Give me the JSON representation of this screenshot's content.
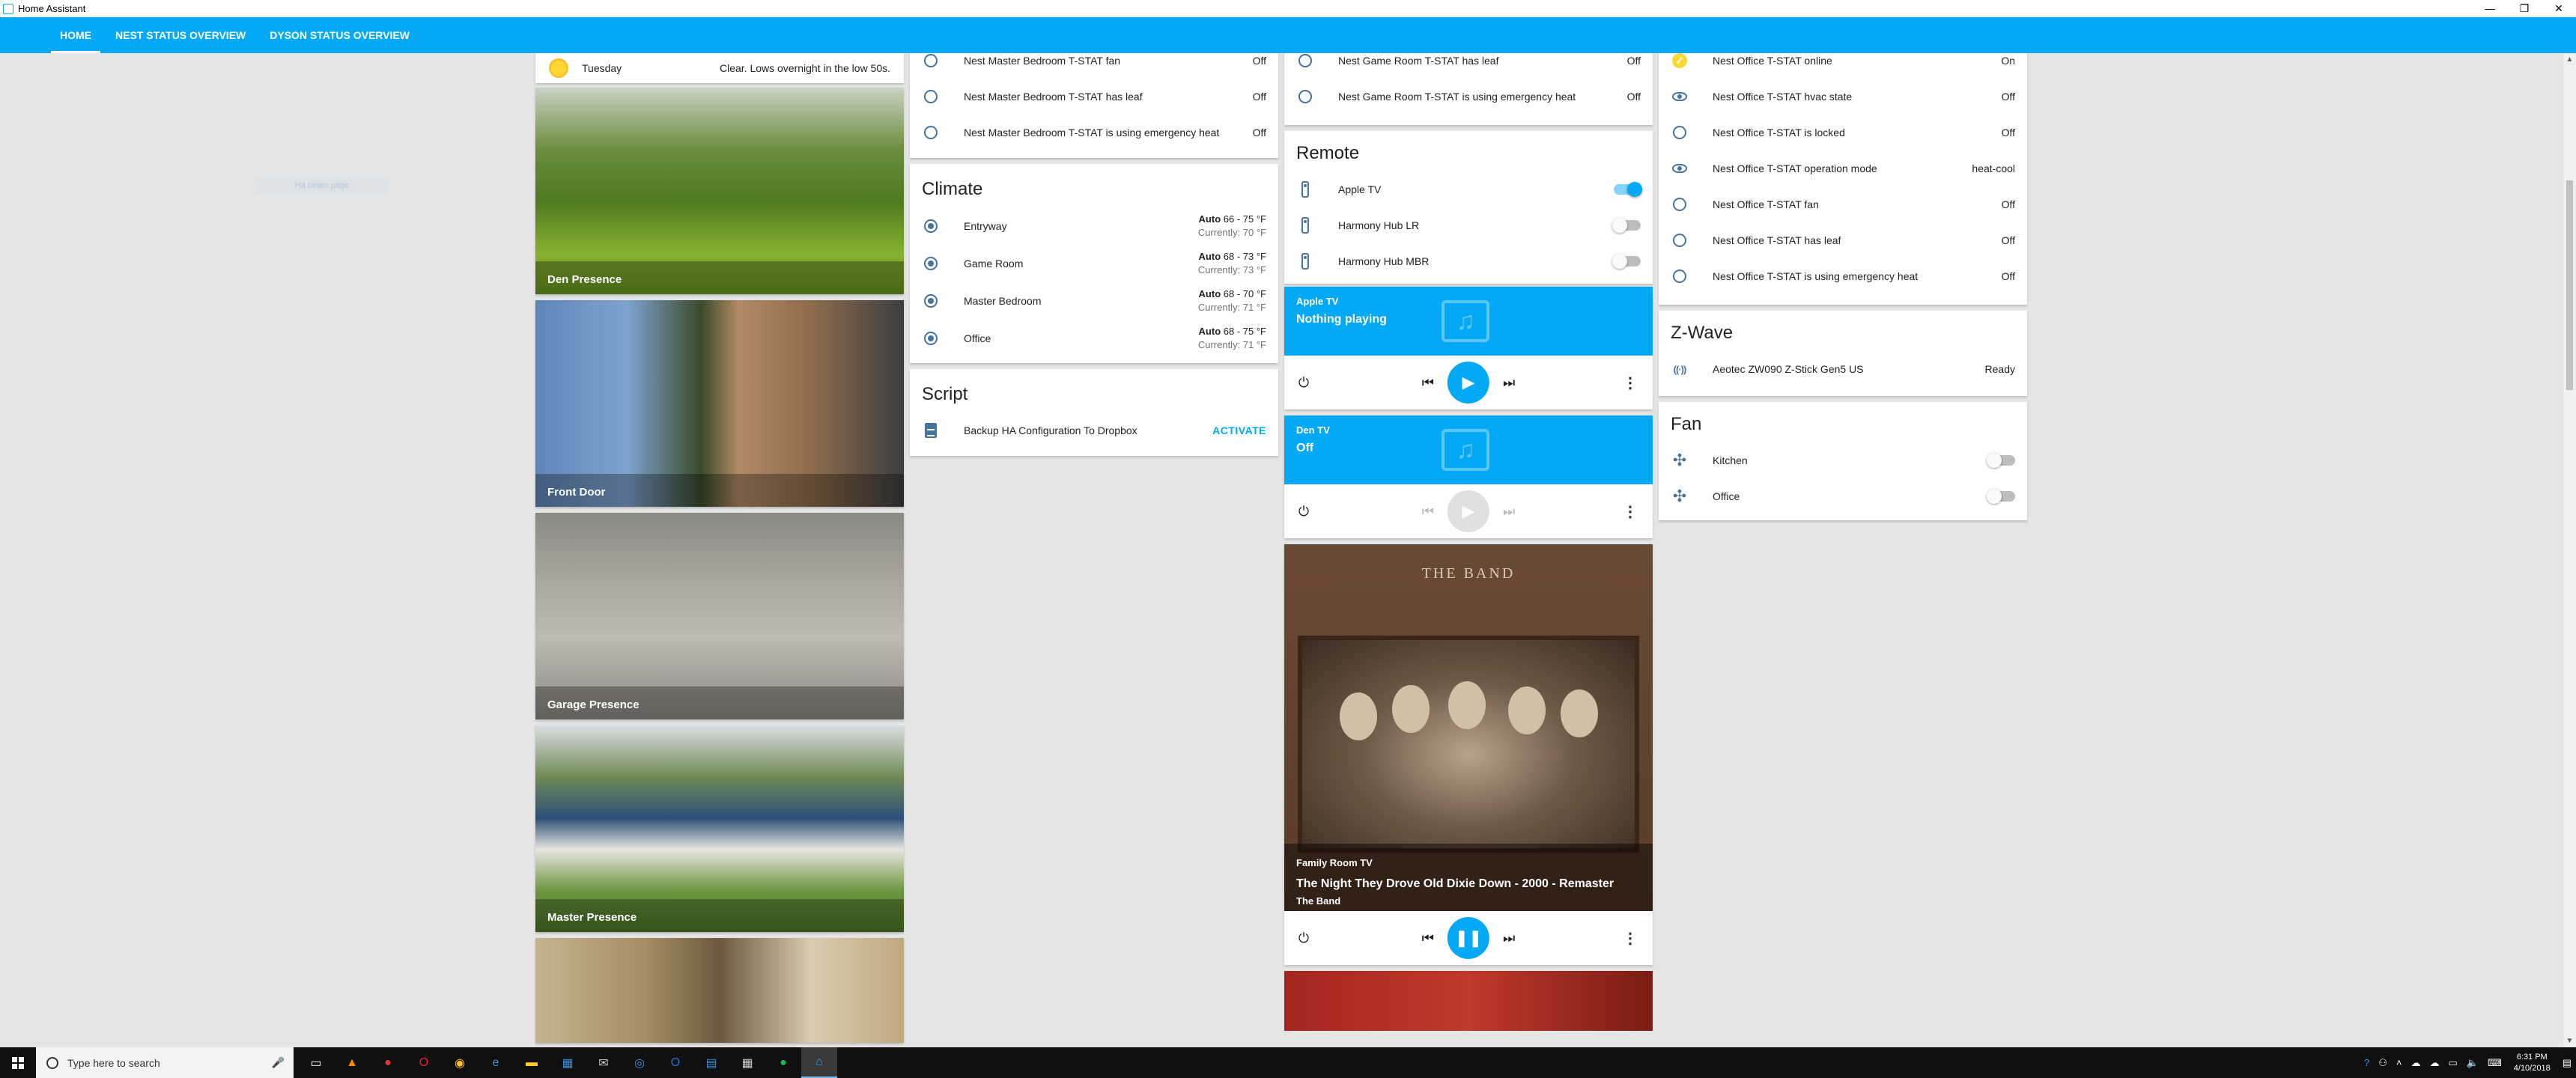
{
  "window": {
    "title": "Home Assistant",
    "minimize": "—",
    "restore": "❐",
    "close": "✕"
  },
  "tabs": [
    {
      "label": "HOME",
      "active": true
    },
    {
      "label": "NEST STATUS OVERVIEW",
      "active": false
    },
    {
      "label": "DYSON STATUS OVERVIEW",
      "active": false
    }
  ],
  "ghost_text": "Ha beam page",
  "weather": {
    "icon": "sun-icon",
    "day": "Tuesday",
    "forecast": "Clear. Lows overnight in the low 50s."
  },
  "cameras": [
    {
      "name": "Den Presence"
    },
    {
      "name": "Front Door"
    },
    {
      "name": "Garage Presence"
    },
    {
      "name": "Master Presence"
    },
    {
      "name": ""
    }
  ],
  "nest_master": [
    {
      "name": "Nest Master Bedroom T-STAT fan",
      "state": "Off"
    },
    {
      "name": "Nest Master Bedroom T-STAT has leaf",
      "state": "Off"
    },
    {
      "name": "Nest Master Bedroom T-STAT is using emergency heat",
      "state": "Off"
    }
  ],
  "climate": {
    "title": "Climate",
    "items": [
      {
        "name": "Entryway",
        "mode": "Auto",
        "range": "66 - 75 °F",
        "current": "Currently: 70 °F"
      },
      {
        "name": "Game Room",
        "mode": "Auto",
        "range": "68 - 73 °F",
        "current": "Currently: 73 °F"
      },
      {
        "name": "Master Bedroom",
        "mode": "Auto",
        "range": "68 - 70 °F",
        "current": "Currently: 71 °F"
      },
      {
        "name": "Office",
        "mode": "Auto",
        "range": "68 - 75 °F",
        "current": "Currently: 71 °F"
      }
    ]
  },
  "script": {
    "title": "Script",
    "item": "Backup HA Configuration To Dropbox",
    "action": "ACTIVATE"
  },
  "nest_game": [
    {
      "name": "Nest Game Room T-STAT has leaf",
      "state": "Off"
    },
    {
      "name": "Nest Game Room T-STAT is using emergency heat",
      "state": "Off"
    }
  ],
  "remote": {
    "title": "Remote",
    "items": [
      {
        "name": "Apple TV",
        "on": true
      },
      {
        "name": "Harmony Hub LR",
        "on": false
      },
      {
        "name": "Harmony Hub MBR",
        "on": false
      }
    ]
  },
  "media": {
    "apple": {
      "source": "Apple TV",
      "state": "Nothing playing"
    },
    "den": {
      "source": "Den TV",
      "state": "Off"
    },
    "family": {
      "album_title": "THE BAND",
      "source": "Family Room TV",
      "track": "The Night They Drove Old Dixie Down - 2000 - Remaster",
      "artist": "The Band"
    }
  },
  "nest_office": [
    {
      "name": "Nest Office T-STAT online",
      "state": "On",
      "icon": "check-icon"
    },
    {
      "name": "Nest Office T-STAT hvac state",
      "state": "Off",
      "icon": "eye-icon"
    },
    {
      "name": "Nest Office T-STAT is locked",
      "state": "Off",
      "icon": "circle-icon"
    },
    {
      "name": "Nest Office T-STAT operation mode",
      "state": "heat-cool",
      "icon": "eye-icon"
    },
    {
      "name": "Nest Office T-STAT fan",
      "state": "Off",
      "icon": "circle-icon"
    },
    {
      "name": "Nest Office T-STAT has leaf",
      "state": "Off",
      "icon": "circle-icon"
    },
    {
      "name": "Nest Office T-STAT is using emergency heat",
      "state": "Off",
      "icon": "circle-icon"
    }
  ],
  "zwave": {
    "title": "Z-Wave",
    "item": "Aeotec ZW090 Z-Stick Gen5 US",
    "state": "Ready"
  },
  "fan": {
    "title": "Fan",
    "items": [
      {
        "name": "Kitchen",
        "on": false
      },
      {
        "name": "Office",
        "on": false
      }
    ]
  },
  "taskbar": {
    "search_placeholder": "Type here to search",
    "time": "6:31 PM",
    "date": "4/10/2018"
  },
  "colors": {
    "accent": "#03a9f4",
    "icon": "#44739e",
    "background": "#e5e5e5"
  }
}
